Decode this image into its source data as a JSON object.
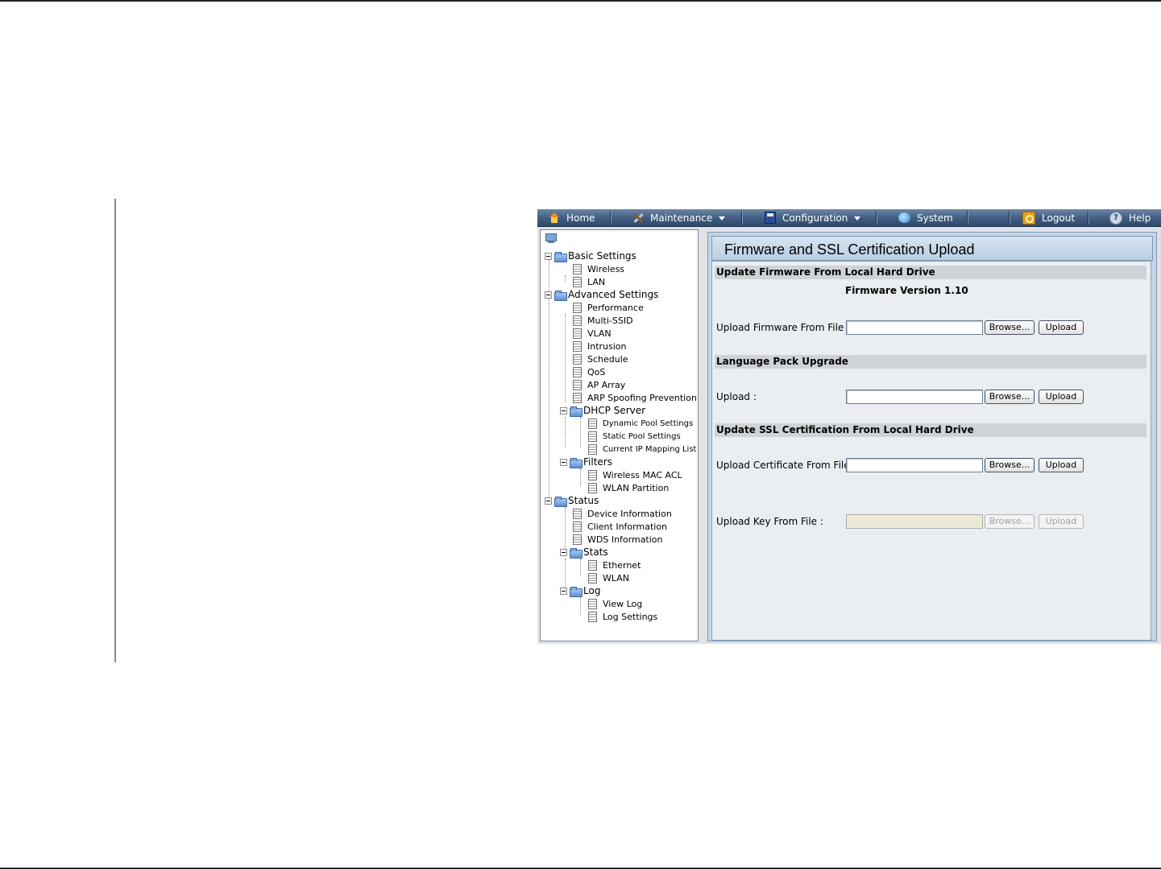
{
  "navbar": {
    "home": "Home",
    "maintenance": "Maintenance",
    "configuration": "Configuration",
    "system": "System",
    "logout": "Logout",
    "help": "Help"
  },
  "tree": {
    "basic_settings": "Basic Settings",
    "wireless": "Wireless",
    "lan": "LAN",
    "advanced_settings": "Advanced Settings",
    "performance": "Performance",
    "multi_ssid": "Multi-SSID",
    "vlan": "VLAN",
    "intrusion": "Intrusion",
    "schedule": "Schedule",
    "qos": "QoS",
    "ap_array": "AP Array",
    "arp_spoofing": "ARP Spoofing Prevention",
    "dhcp_server": "DHCP Server",
    "dynamic_pool": "Dynamic Pool Settings",
    "static_pool": "Static Pool Settings",
    "current_ip": "Current IP Mapping List",
    "filters": "Filters",
    "wireless_mac_acl": "Wireless MAC ACL",
    "wlan_partition": "WLAN Partition",
    "status": "Status",
    "device_information": "Device Information",
    "client_information": "Client Information",
    "wds_information": "WDS Information",
    "stats": "Stats",
    "ethernet": "Ethernet",
    "wlan": "WLAN",
    "log": "Log",
    "view_log": "View Log",
    "log_settings": "Log Settings"
  },
  "panel": {
    "title": "Firmware and SSL Certification Upload",
    "firmware_section": "Update Firmware From Local Hard Drive",
    "firmware_version": "Firmware Version 1.10",
    "upload_firmware_label": "Upload Firmware From File :",
    "language_section": "Language Pack Upgrade",
    "upload_language_label": "Upload :",
    "ssl_section": "Update SSL Certification From Local Hard Drive",
    "upload_cert_label": "Upload Certificate From File :",
    "upload_key_label": "Upload Key From File :",
    "browse_label": "Browse...",
    "upload_label": "Upload"
  }
}
